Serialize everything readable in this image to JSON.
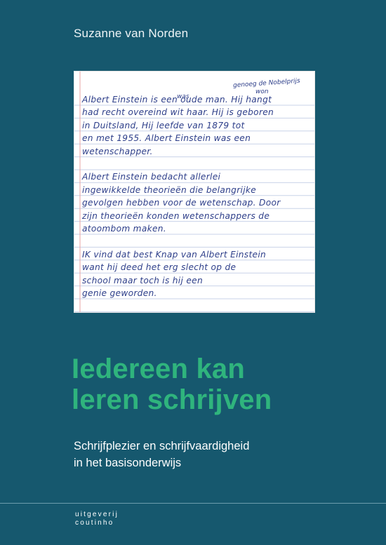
{
  "author": "Suzanne van Norden",
  "handwriting": {
    "notes": [
      "was",
      "genoeg de Nobelprijs",
      "won"
    ],
    "lines": [
      "Albert Einstein is een oude man. Hij hangt",
      "had recht overeind wit haar. Hij is geboren",
      "in Duitsland, Hij leefde van 1879 tot",
      "en met 1955. Albert Einstein was een",
      "wetenschapper.",
      "",
      "Albert Einstein bedacht allerlei",
      "ingewikkelde theorieën die belangrijke",
      "gevolgen hebben voor de wetenschap. Door",
      "zijn theorieën konden wetenschappers de",
      "atoombom maken.",
      "",
      "IK vind dat best Knap van Albert Einstein",
      "want hij deed het erg slecht op de",
      "school maar toch is hij een",
      "genie geworden."
    ]
  },
  "title": {
    "line1": "Iedereen kan",
    "line2": "leren schrijven"
  },
  "subtitle": {
    "line1": "Schrijfplezier en schrijfvaardigheid",
    "line2": "in het basisonderwijs"
  },
  "publisher": {
    "line1": "uitgeverij",
    "line2": "coutinho"
  },
  "colors": {
    "background": "#16586e",
    "title": "#2fb47d",
    "ink": "#2e3f8a",
    "paper_rule": "#c9d3e8",
    "paper_margin": "#e8a3a3"
  }
}
